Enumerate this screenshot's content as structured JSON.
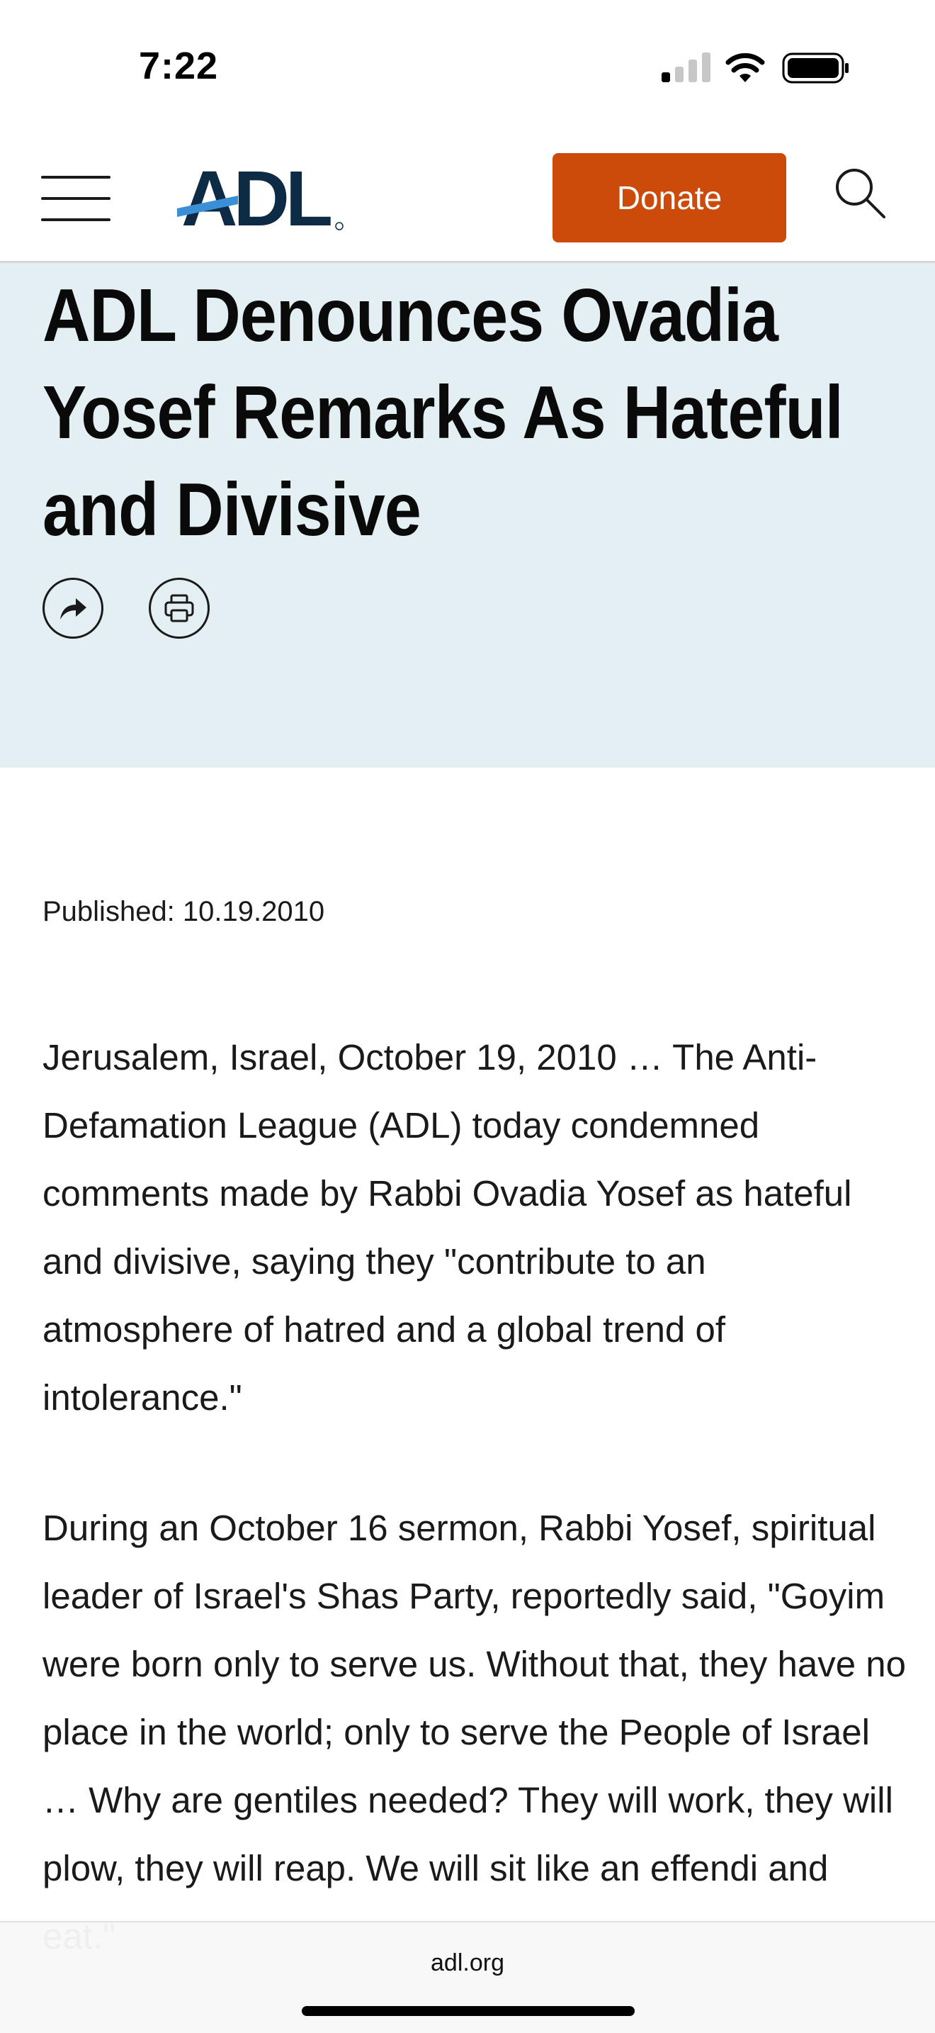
{
  "status_bar": {
    "time": "7:22"
  },
  "header": {
    "logo_text": "ADL",
    "donate_label": "Donate"
  },
  "hero": {
    "title": "ADL Denounces Ovadia Yosef Remarks As Hateful and Divisive"
  },
  "article": {
    "published": "Published: 10.19.2010",
    "paragraphs": [
      "Jerusalem, Israel, October 19, 2010 … The Anti-Defamation League (ADL) today condemned comments made by Rabbi Ovadia Yosef as hateful and divisive, saying they \"contribute to an atmosphere of hatred and a global trend of intolerance.\"",
      "During an October 16 sermon, Rabbi Yosef, spiritual leader of Israel's Shas Party, reportedly said, \"Goyim were born only to serve us. Without that, they have no place in the world; only to serve the People of Israel … Why are gentiles needed? They will work, they will plow, they will reap. We will sit like an effendi and eat.\""
    ]
  },
  "browser": {
    "url": "adl.org"
  },
  "colors": {
    "donate_bg": "#cc4a0a",
    "hero_bg": "#e3eff3",
    "logo_navy": "#0d2b45",
    "logo_blue": "#3a8fd6"
  },
  "icons": [
    "menu-icon",
    "search-icon",
    "share-icon",
    "print-icon",
    "signal-icon",
    "wifi-icon",
    "battery-icon"
  ]
}
